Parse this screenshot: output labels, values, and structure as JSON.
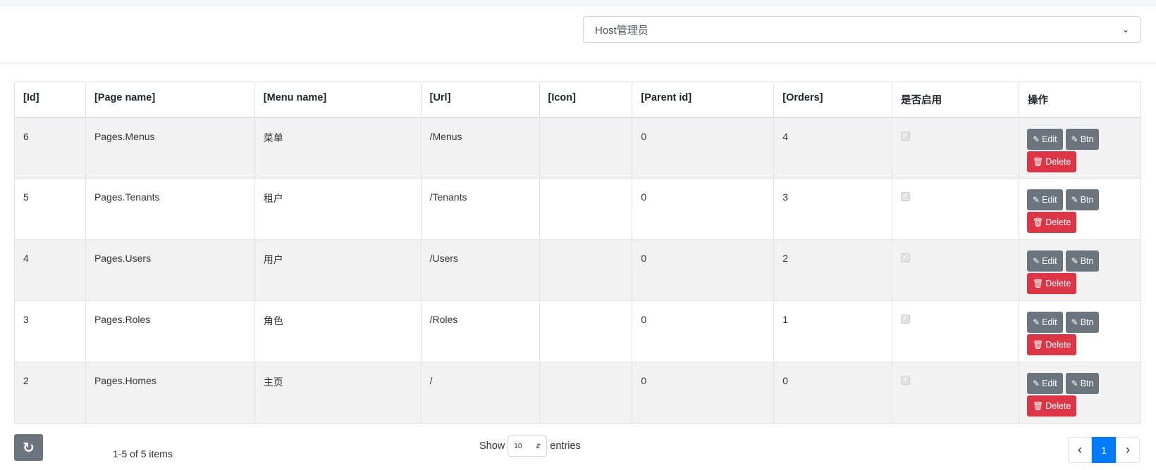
{
  "role_select": {
    "value": "Host管理员",
    "chevron": "chevron-down-icon"
  },
  "table": {
    "columns": [
      "[Id]",
      "[Page name]",
      "[Menu name]",
      "[Url]",
      "[Icon]",
      "[Parent id]",
      "[Orders]",
      "是否启用",
      "操作"
    ],
    "rows": [
      {
        "id": "6",
        "page": "Pages.Menus",
        "menu": "菜单",
        "url": "/Menus",
        "icon": "",
        "parent": "0",
        "orders": "4",
        "enabled": true
      },
      {
        "id": "5",
        "page": "Pages.Tenants",
        "menu": "租户",
        "url": "/Tenants",
        "icon": "",
        "parent": "0",
        "orders": "3",
        "enabled": true
      },
      {
        "id": "4",
        "page": "Pages.Users",
        "menu": "用户",
        "url": "/Users",
        "icon": "",
        "parent": "0",
        "orders": "2",
        "enabled": true
      },
      {
        "id": "3",
        "page": "Pages.Roles",
        "menu": "角色",
        "url": "/Roles",
        "icon": "",
        "parent": "0",
        "orders": "1",
        "enabled": true
      },
      {
        "id": "2",
        "page": "Pages.Homes",
        "menu": "主页",
        "url": "/",
        "icon": "",
        "parent": "0",
        "orders": "0",
        "enabled": true
      }
    ],
    "actions": {
      "edit": "Edit",
      "btn": "Btn",
      "delete": "Delete"
    }
  },
  "footer": {
    "items_info": "1-5 of 5 items",
    "show_label": "Show",
    "entries_label": "entries",
    "page_size": "10",
    "current_page": "1"
  },
  "colors": {
    "primary": "#007bff",
    "secondary": "#6c757d",
    "danger": "#dc3545"
  }
}
